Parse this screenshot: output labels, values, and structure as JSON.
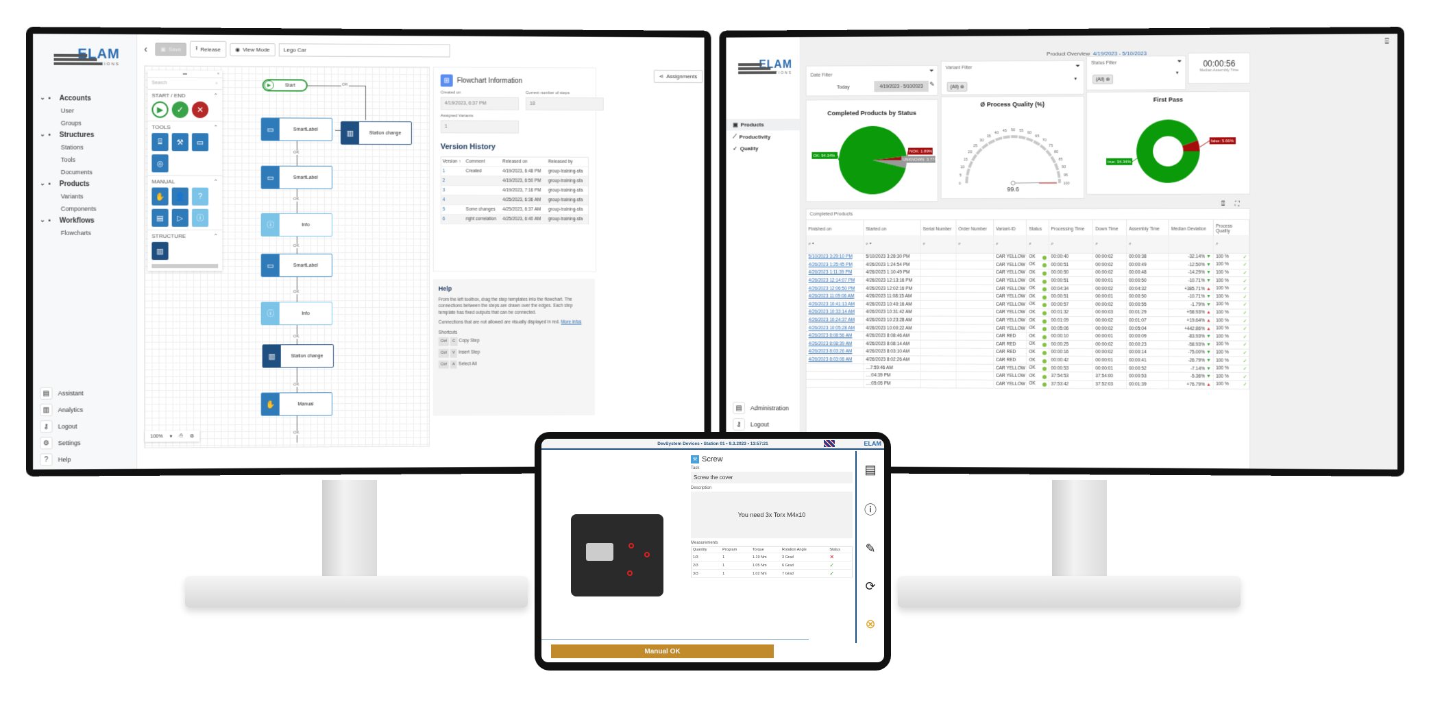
{
  "left_app": {
    "logo": {
      "word": "ELAM",
      "sub": "SOLUTIONS"
    },
    "toolbar": {
      "back": "‹",
      "save": "Save",
      "release": "Release",
      "view_mode": "View Mode",
      "name_value": "Lego Car",
      "assignments": "Assignments"
    },
    "nav": [
      {
        "label": "Accounts",
        "icon": "users-icon",
        "children": [
          "User",
          "Groups"
        ]
      },
      {
        "label": "Structures",
        "icon": "structure-icon",
        "children": [
          "Stations",
          "Tools",
          "Documents"
        ]
      },
      {
        "label": "Products",
        "icon": "briefcase-icon",
        "children": [
          "Variants",
          "Components"
        ]
      },
      {
        "label": "Workflows",
        "icon": "workflow-icon",
        "children": [
          "Flowcharts"
        ]
      }
    ],
    "bottom_nav": [
      {
        "label": "Assistant",
        "icon": "▤"
      },
      {
        "label": "Analytics",
        "icon": "▥"
      },
      {
        "label": "Logout",
        "icon": "⚷"
      },
      {
        "label": "Settings",
        "icon": "⚙"
      },
      {
        "label": "Help",
        "icon": "?"
      }
    ],
    "palette": {
      "search_placeholder": "Search",
      "sections": [
        "START / END",
        "TOOLS",
        "MANUAL",
        "STRUCTURE"
      ]
    },
    "zoom_value": "100%",
    "flow": {
      "nodes": [
        "Start",
        "SmartLabel",
        "Station change",
        "SmartLabel",
        "Info",
        "SmartLabel",
        "Info",
        "Station change",
        "Manual"
      ],
      "edge_label": "OK"
    },
    "info": {
      "title": "Flowchart Information",
      "created_label": "Created on",
      "created_value": "4/19/2023, 6:37 PM",
      "steps_label": "Current number of steps",
      "steps_value": "18",
      "variants_label": "Assigned Variants",
      "variants_value": "1",
      "version_title": "Version History",
      "version_headers": [
        "Version ↑",
        "Comment",
        "Released on",
        "Released by"
      ],
      "versions": [
        [
          "1",
          "Created",
          "4/19/2023, 6:48 PM",
          "group-training-sfa"
        ],
        [
          "2",
          "",
          "4/19/2023, 6:50 PM",
          "group-training-sfa"
        ],
        [
          "3",
          "",
          "4/19/2023, 7:16 PM",
          "group-training-sfa"
        ],
        [
          "4",
          "",
          "4/25/2023, 6:36 AM",
          "group-training-sfa"
        ],
        [
          "5",
          "Some changes",
          "4/25/2023, 6:37 AM",
          "group-training-sfa"
        ],
        [
          "6",
          "right correlation",
          "4/25/2023, 6:40 AM",
          "group-training-sfa"
        ]
      ]
    },
    "help": {
      "title": "Help",
      "p1": "From the left toolbox, drag the step templates into the flowchart. The connections between the steps are drawn over the edges. Each step template has fixed outputs that can be connected.",
      "p2": "Connections that are not allowed are visually displayed in red.",
      "more": "More infos",
      "shortcuts_title": "Shortcuts",
      "shortcuts": [
        [
          "Ctrl",
          "C",
          "Copy Step"
        ],
        [
          "Ctrl",
          "V",
          "Insert Step"
        ],
        [
          "Ctrl",
          "A",
          "Select All"
        ]
      ]
    }
  },
  "right_app": {
    "logo": {
      "word": "ELAM",
      "sub": "SOLUTIONS"
    },
    "nav": [
      "Products",
      "Productivity",
      "Quality"
    ],
    "bottom_nav": [
      "Administration",
      "Logout"
    ],
    "header": {
      "title": "Product Overview",
      "range": "4/19/2023 - 5/10/2023"
    },
    "date_filter": {
      "label": "Date Filter",
      "today": "Today",
      "range": "4/19/2023 - 5/10/2023"
    },
    "variant_filter": {
      "label": "Variant Filter",
      "chip": "(All)"
    },
    "status_filter": {
      "label": "Status Filter",
      "chip": "(All)"
    },
    "median": {
      "value": "00:00:56",
      "label": "Median Assembly Time"
    },
    "table_title": "Completed Products",
    "columns": [
      "Finished on",
      "Started on",
      "Serial Number",
      "Order Number",
      "Variant-ID",
      "Status",
      "Processing Time",
      "Down Time",
      "Assembly Time",
      "Median Deviation",
      "Process Quality"
    ],
    "rows": [
      [
        "5/10/2023 3:29:10 PM",
        "5/10/2023 3:28:30 PM",
        "",
        "",
        "CAR YELLOW",
        "OK",
        "00:00:40",
        "00:00:02",
        "00:00:38",
        "-32.14%",
        "100 %"
      ],
      [
        "4/26/2023 1:25:45 PM",
        "4/26/2023 1:24:54 PM",
        "",
        "",
        "CAR YELLOW",
        "OK",
        "00:00:51",
        "00:00:02",
        "00:00:49",
        "-12.50%",
        "100 %"
      ],
      [
        "4/26/2023 1:11:39 PM",
        "4/26/2023 1:10:49 PM",
        "",
        "",
        "CAR YELLOW",
        "OK",
        "00:00:50",
        "00:00:02",
        "00:00:48",
        "-14.29%",
        "100 %"
      ],
      [
        "4/26/2023 12:14:07 PM",
        "4/26/2023 12:13:16 PM",
        "",
        "",
        "CAR YELLOW",
        "OK",
        "00:00:51",
        "00:00:01",
        "00:00:50",
        "-10.71%",
        "100 %"
      ],
      [
        "4/26/2023 12:06:50 PM",
        "4/26/2023 12:02:16 PM",
        "",
        "",
        "CAR YELLOW",
        "OK",
        "00:04:34",
        "00:00:02",
        "00:04:32",
        "+385.71%",
        "100 %"
      ],
      [
        "4/26/2023 11:09:06 AM",
        "4/26/2023 11:08:15 AM",
        "",
        "",
        "CAR YELLOW",
        "OK",
        "00:00:51",
        "00:00:01",
        "00:00:50",
        "-10.71%",
        "100 %"
      ],
      [
        "4/26/2023 10:41:13 AM",
        "4/26/2023 10:40:16 AM",
        "",
        "",
        "CAR YELLOW",
        "OK",
        "00:00:57",
        "00:00:02",
        "00:00:55",
        "-1.79%",
        "100 %"
      ],
      [
        "4/26/2023 10:33:14 AM",
        "4/26/2023 10:31:42 AM",
        "",
        "",
        "CAR YELLOW",
        "OK",
        "00:01:32",
        "00:00:03",
        "00:01:29",
        "+58.93%",
        "100 %"
      ],
      [
        "4/26/2023 10:24:37 AM",
        "4/26/2023 10:23:28 AM",
        "",
        "",
        "CAR YELLOW",
        "OK",
        "00:01:09",
        "00:00:02",
        "00:01:07",
        "+19.64%",
        "100 %"
      ],
      [
        "4/26/2023 10:05:28 AM",
        "4/26/2023 10:00:22 AM",
        "",
        "",
        "CAR YELLOW",
        "OK",
        "00:05:06",
        "00:00:02",
        "00:05:04",
        "+442.86%",
        "100 %"
      ],
      [
        "4/26/2023 8:08:56 AM",
        "4/26/2023 8:08:46 AM",
        "",
        "",
        "CAR RED",
        "OK",
        "00:00:10",
        "00:00:01",
        "00:00:09",
        "-83.93%",
        "100 %"
      ],
      [
        "4/26/2023 8:08:39 AM",
        "4/26/2023 8:08:14 AM",
        "",
        "",
        "CAR RED",
        "OK",
        "00:00:25",
        "00:00:02",
        "00:00:23",
        "-58.93%",
        "100 %"
      ],
      [
        "4/26/2023 8:03:26 AM",
        "4/26/2023 8:03:10 AM",
        "",
        "",
        "CAR RED",
        "OK",
        "00:00:16",
        "00:00:02",
        "00:00:14",
        "-75.00%",
        "100 %"
      ],
      [
        "4/26/2023 8:03:08 AM",
        "4/26/2023 8:02:26 AM",
        "",
        "",
        "CAR RED",
        "OK",
        "00:00:42",
        "00:00:01",
        "00:00:41",
        "-26.79%",
        "100 %"
      ],
      [
        "",
        "…7:59:46 AM",
        "",
        "",
        "CAR YELLOW",
        "OK",
        "00:00:53",
        "00:00:01",
        "00:00:52",
        "-7.14%",
        "100 %"
      ],
      [
        "",
        "…:04:39 PM",
        "",
        "",
        "CAR YELLOW",
        "OK",
        "37:54:53",
        "37:54:00",
        "00:00:53",
        "-5.36%",
        "100 %"
      ],
      [
        "",
        "…:05:05 PM",
        "",
        "",
        "CAR YELLOW",
        "OK",
        "37:53:42",
        "37:52:03",
        "00:01:39",
        "+76.79%",
        "100 %"
      ]
    ]
  },
  "chart_data": [
    {
      "type": "pie",
      "title": "Completed Products by Status",
      "slices": [
        {
          "label": "OK",
          "value": 94.34,
          "color": "#0a9a0a"
        },
        {
          "label": "NOK",
          "value": 1.89,
          "color": "#a50d0d"
        },
        {
          "label": "UNKNOWN",
          "value": 3.77,
          "color": "#999999"
        }
      ],
      "labels": [
        "OK: 94.34%",
        "NOK: 1.89%",
        "UNKNOWN: 3.77%"
      ]
    },
    {
      "type": "gauge",
      "title": "Ø Process Quality (%)",
      "value": 99.6,
      "range": [
        0,
        100
      ],
      "ticks": [
        0,
        5,
        10,
        15,
        20,
        25,
        30,
        35,
        40,
        45,
        50,
        55,
        60,
        65,
        70,
        75,
        80,
        85,
        90,
        95,
        100
      ]
    },
    {
      "type": "pie",
      "subtype": "donut",
      "title": "First Pass",
      "slices": [
        {
          "label": "true",
          "value": 94.34,
          "color": "#0a9a0a"
        },
        {
          "label": "false",
          "value": 5.66,
          "color": "#a50d0d"
        }
      ],
      "labels": [
        "true: 94.34%",
        "false: 5.66%"
      ]
    }
  ],
  "tablet": {
    "header": "DevSystem Devices • Station 01 • 9.3.2023 • 13:57:21",
    "step_title": "Screw",
    "task_label": "Task",
    "task_value": "Screw the cover",
    "desc_label": "Description",
    "desc_value": "You need 3x Torx M4x10",
    "meas_label": "Measurements",
    "meas_headers": [
      "Quantity",
      "Program",
      "Torque",
      "Rotation Angle",
      "Status"
    ],
    "meas_rows": [
      [
        "1/3",
        "1",
        "1.19 Nm",
        "3 Grad",
        "✕"
      ],
      [
        "2/3",
        "1",
        "1.05 Nm",
        "6 Grad",
        "✓"
      ],
      [
        "3/3",
        "1",
        "1.02 Nm",
        "7 Grad",
        "✓"
      ]
    ],
    "button": "Manual OK"
  }
}
